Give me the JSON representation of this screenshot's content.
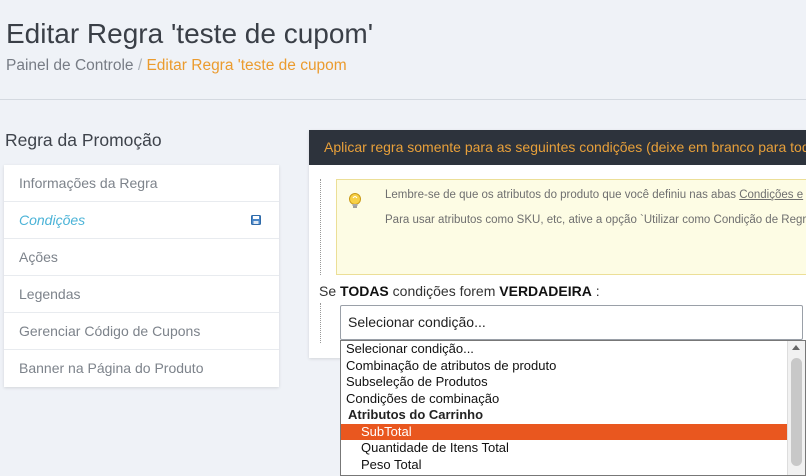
{
  "header": {
    "title": "Editar Regra 'teste de cupom'",
    "breadcrumb": {
      "root": "Painel de Controle",
      "separator": " / ",
      "current": "Editar Regra 'teste de cupom"
    }
  },
  "sidebar": {
    "title": "Regra da Promoção",
    "items": [
      {
        "label": "Informações da Regra"
      },
      {
        "label": "Condições"
      },
      {
        "label": "Ações"
      },
      {
        "label": "Legendas"
      },
      {
        "label": "Gerenciar Código de Cupons"
      },
      {
        "label": "Banner na Página do Produto"
      }
    ],
    "active_index": 1
  },
  "panel": {
    "header": "Aplicar regra somente para as seguintes condições (deixe em branco para todos os produtos)",
    "notice": {
      "line1_prefix": "Lembre-se de que os atributos do produto que você definiu nas abas ",
      "line1_link": "Condições e",
      "line2": "Para usar atributos como SKU, etc, ative a opção `Utilizar como Condição de Regras"
    },
    "condition": {
      "prefix": "Se ",
      "aggregator": "TODAS",
      "middle": "  condições forem ",
      "value": "VERDADEIRA",
      "suffix": " :"
    }
  },
  "select": {
    "value": "Selecionar condição...",
    "options": [
      {
        "label": "Selecionar condição...",
        "kind": "option"
      },
      {
        "label": "Combinação de atributos de produto",
        "kind": "option"
      },
      {
        "label": "Subseleção de Produtos",
        "kind": "option"
      },
      {
        "label": "Condições de combinação",
        "kind": "option"
      },
      {
        "label": "Atributos do Carrinho",
        "kind": "group"
      },
      {
        "label": "SubTotal",
        "kind": "sub",
        "selected": true
      },
      {
        "label": "Quantidade de Itens Total",
        "kind": "sub"
      },
      {
        "label": "Peso Total",
        "kind": "sub"
      }
    ]
  },
  "colors": {
    "accent_orange": "#eb9b2e",
    "active_blue": "#4bb3d7",
    "panel_dark": "#2d333c",
    "selected_option": "#e9571f"
  },
  "icons": {
    "save": "floppy-disk-icon",
    "notice": "lightbulb-icon"
  }
}
